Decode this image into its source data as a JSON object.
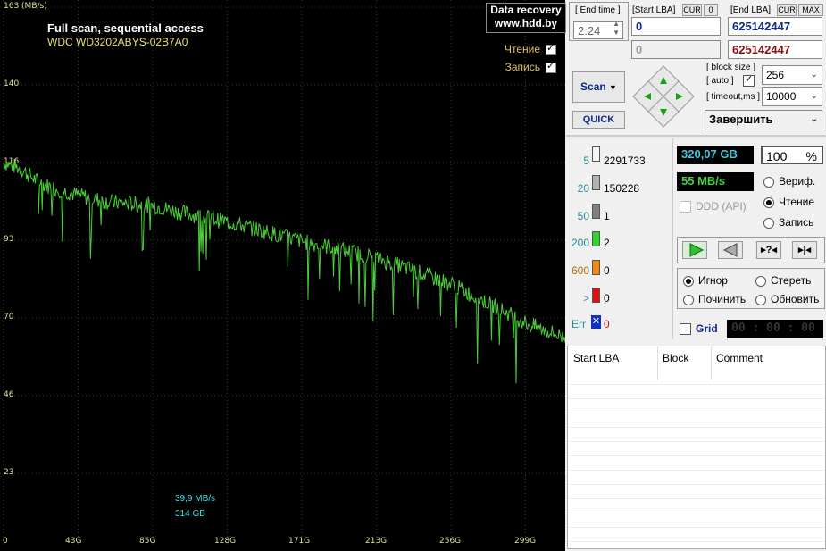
{
  "graph": {
    "y_unit_label": "163 (MB/s)",
    "y_ticks": [
      "140",
      "116",
      "93",
      "70",
      "46",
      "23"
    ],
    "x_ticks": [
      "0",
      "43G",
      "85G",
      "128G",
      "171G",
      "213G",
      "256G",
      "299G"
    ],
    "title": "Full scan, sequential access",
    "drive": "WDC WD3202ABYS-02B7A0",
    "brand_line1": "Data recovery",
    "brand_line2": "www.hdd.by",
    "legend_read": "Чтение",
    "legend_write": "Запись",
    "cursor_speed": "39,9 MB/s",
    "cursor_size": "314 GB",
    "line_color": "#4ccc3a"
  },
  "controls": {
    "end_time_label": "[ End time ]",
    "end_time_value": "2:24",
    "start_lba_label": "[Start LBA]",
    "cur_label": "CUR",
    "zero_label": "0",
    "end_lba_label": "[End LBA]",
    "max_label": "MAX",
    "start_lba_value": "0",
    "start_lba_value2": "0",
    "end_lba_value": "625142447",
    "end_lba_value2": "625142447",
    "scan_label": "Scan",
    "quick_label": "QUICK",
    "block_size_label": "[ block size ]",
    "auto_label": "[ auto ]",
    "timeout_label": "[ timeout,ms ]",
    "block_size_value": "256",
    "timeout_value": "10000",
    "finish_value": "Завершить"
  },
  "stats": {
    "rows": [
      {
        "label": "5",
        "value": "2291733",
        "color": "#f4f4f4"
      },
      {
        "label": "20",
        "value": "150228",
        "color": "#b0b0b0"
      },
      {
        "label": "50",
        "value": "1",
        "color": "#808080"
      },
      {
        "label": "200",
        "value": "2",
        "color": "#2dd62d"
      },
      {
        "label": "600",
        "value": "0",
        "color": "#f08a10"
      },
      {
        "label": ">",
        "value": "0",
        "color": "#e01010"
      }
    ],
    "err_label": "Err",
    "err_value": "0",
    "capacity": "320,07 GB",
    "percent": "100",
    "percent_sign": "%",
    "speed": "55 MB/s",
    "ddd_label": "DDD (API)",
    "mode_verify": "Вериф.",
    "mode_read": "Чтение",
    "mode_write": "Запись",
    "opt_ignore": "Игнор",
    "opt_erase": "Стереть",
    "opt_repair": "Починить",
    "opt_refresh": "Обновить",
    "grid_label": "Grid",
    "timer": "00 : 00 : 00"
  },
  "table": {
    "headers": [
      "Start LBA",
      "Block",
      "Comment"
    ]
  },
  "chart_data": {
    "type": "line",
    "ylim": [
      0,
      163
    ],
    "ylabel": "(MB/s)",
    "xlim": [
      0,
      320
    ],
    "x_unit": "GB",
    "series": [
      {
        "values_x": [
          0,
          10,
          20,
          30,
          43,
          60,
          85,
          100,
          128,
          150,
          171,
          190,
          213,
          235,
          256,
          270,
          285,
          299,
          320
        ],
        "values_y": [
          116,
          114,
          110,
          108,
          106,
          104,
          103,
          101,
          98,
          95,
          92,
          90,
          87,
          83,
          79,
          75,
          71,
          67,
          63
        ]
      }
    ]
  }
}
